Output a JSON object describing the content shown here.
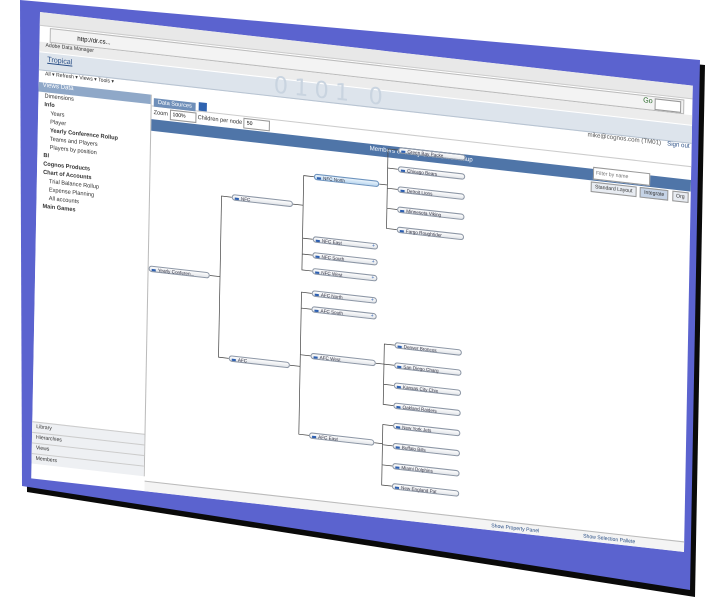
{
  "browser": {
    "address": "http://dr.cs...",
    "go_label": "Go",
    "favorites_label": "Adobe Data Manager"
  },
  "app": {
    "title": "Tropical",
    "banner_deco": "0101 0",
    "menu_text": "All ▾ Refresh ▾ Views ▾ Tools ▾",
    "user": "mike@cognos.com (TM01)",
    "sign_out": "Sign out"
  },
  "left_panel": {
    "header": "Views Data",
    "tree": [
      "Dimensions",
      "Info",
      "Years",
      "Player",
      "Yearly Conference Rollup",
      "Teams and Players",
      "Players by position",
      "BI",
      "Cognos Products",
      "Chart of Accounts",
      "Trial Balance Rollup",
      "Expense Planning",
      "All accounts",
      "Main Games"
    ],
    "bottom_tabs": [
      "Library",
      "Hierarchies",
      "Views",
      "Members"
    ]
  },
  "main": {
    "tab_label": "Data Sources",
    "zoom_label": "Zoom",
    "zoom_value": "100%",
    "children_label": "Children per node",
    "children_value": "50",
    "view_title": "Members of Yearly Conference Rollup",
    "filter_placeholder": "Filter by name",
    "buttons": [
      "Standard Layout",
      "Integrate",
      "Org"
    ],
    "bottom_left": "Show Property Panel",
    "bottom_right": "Show Selection Pallete"
  },
  "tree": {
    "nodes": [
      "Yearly Conferen...",
      "NFC",
      "AFC",
      "NFC North",
      "NFC East",
      "NFC South",
      "NFC West",
      "AFC North",
      "AFC South",
      "AFC West",
      "AFC East",
      "Green Bay Packe",
      "Chicago Bears",
      "Detroit Lions",
      "Minnesota Viking",
      "Fargo Roughrider",
      "Denver Broncos",
      "San Diego Charg",
      "Kansas City Chie",
      "Oakland Raiders",
      "New York Jets",
      "Buffalo Bills",
      "Miami Dolphins",
      "New England Pat"
    ]
  }
}
